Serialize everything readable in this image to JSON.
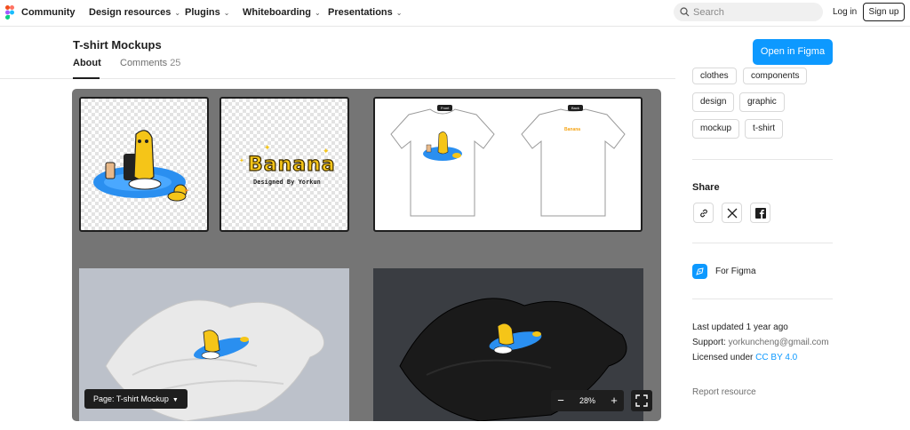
{
  "topbar": {
    "brand": "Community",
    "nav": [
      "Design resources",
      "Plugins",
      "Whiteboarding",
      "Presentations"
    ],
    "search_placeholder": "Search",
    "login": "Log in",
    "signup": "Sign up"
  },
  "resource": {
    "title": "T-shirt Mockups",
    "tabs": {
      "about": "About",
      "comments": "Comments",
      "comments_count": "25"
    },
    "open_button": "Open in Figma"
  },
  "preview": {
    "page_select": "Page: T-shirt Mockup",
    "zoom": "28%",
    "zoom_out": "−",
    "zoom_in": "+",
    "banana_logo": "Banana",
    "banana_sub": "Designed By Yorkun",
    "front_tag": "Front",
    "back_tag": "Back",
    "back_logo": "Banana"
  },
  "sidebar": {
    "tags": [
      "clothes",
      "components",
      "design",
      "graphic",
      "mockup",
      "t-shirt"
    ],
    "share_title": "Share",
    "for_figma": "For Figma",
    "last_updated": "Last updated 1 year ago",
    "support_label": "Support:",
    "support_email": "yorkuncheng@gmail.com",
    "license_label": "Licensed under",
    "license": "CC BY 4.0",
    "report": "Report resource"
  },
  "colors": {
    "accent": "#0d99ff",
    "preview_bg": "#757575",
    "banana": "#f5c518",
    "pool": "#2a8ff0"
  }
}
